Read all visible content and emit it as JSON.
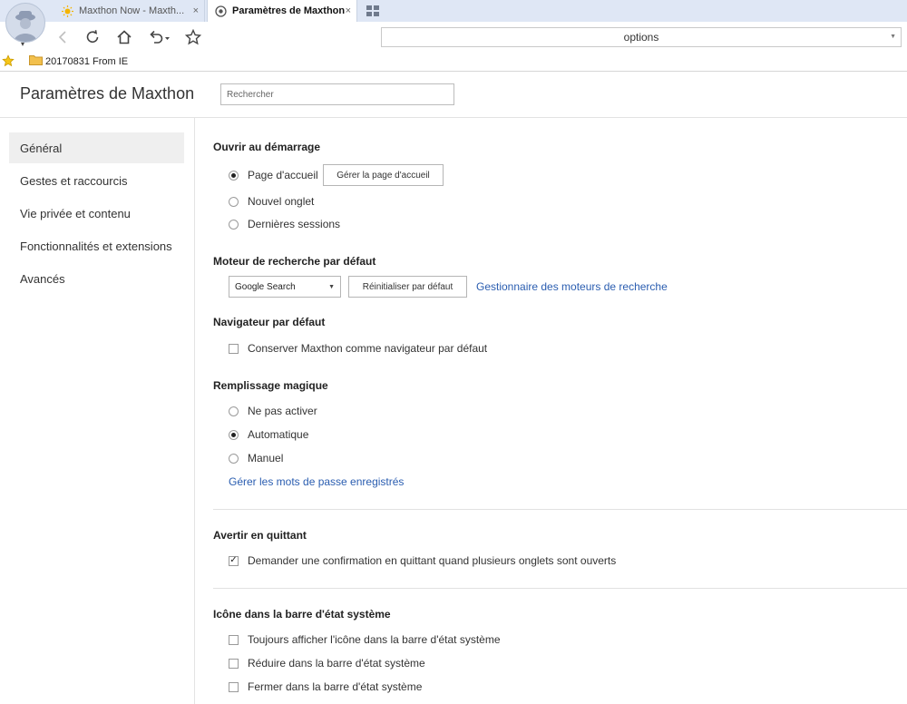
{
  "browser": {
    "tabs": [
      {
        "title": "Maxthon Now - Maxth...",
        "active": false
      },
      {
        "title": "Paramètres de Maxthon",
        "active": true
      }
    ],
    "close_glyph": "×",
    "address": "options",
    "favorites": [
      {
        "label": "20170831 From IE"
      }
    ],
    "icons": [
      "user-avatar-icon",
      "sun-icon",
      "settings-icon",
      "tile-grid-icon",
      "back-icon",
      "reload-icon",
      "home-icon",
      "undo-icon",
      "star-icon",
      "folder-icon"
    ]
  },
  "header": {
    "title": "Paramètres de Maxthon",
    "search_placeholder": "Rechercher"
  },
  "sidebar": {
    "items": [
      {
        "label": "Général",
        "selected": true
      },
      {
        "label": "Gestes et raccourcis"
      },
      {
        "label": "Vie privée et contenu"
      },
      {
        "label": "Fonctionnalités et extensions"
      },
      {
        "label": "Avancés"
      }
    ]
  },
  "sections": {
    "startup": {
      "title": "Ouvrir au démarrage",
      "options": [
        {
          "label": "Page d'accueil",
          "checked": true
        },
        {
          "label": "Nouvel onglet",
          "checked": false
        },
        {
          "label": "Dernières sessions",
          "checked": false
        }
      ],
      "manage_home_button": "Gérer la page d'accueil"
    },
    "search_engine": {
      "title": "Moteur de recherche par défaut",
      "selected": "Google Search",
      "reset_button": "Réinitialiser par défaut",
      "manager_link": "Gestionnaire des moteurs de recherche"
    },
    "default_browser": {
      "title": "Navigateur par défaut",
      "option": {
        "label": "Conserver Maxthon comme navigateur par défaut",
        "checked": false
      }
    },
    "magic_fill": {
      "title": "Remplissage magique",
      "options": [
        {
          "label": "Ne pas activer",
          "checked": false
        },
        {
          "label": "Automatique",
          "checked": true
        },
        {
          "label": "Manuel",
          "checked": false
        }
      ],
      "passwords_link": "Gérer les mots de passe enregistrés"
    },
    "quit_warning": {
      "title": "Avertir en quittant",
      "option": {
        "label": "Demander une confirmation en quittant quand plusieurs onglets sont ouverts",
        "checked": true
      }
    },
    "tray": {
      "title": "Icône dans la barre d'état système",
      "options": [
        {
          "label": "Toujours afficher l'icône dans la barre d'état système",
          "checked": false
        },
        {
          "label": "Réduire dans la barre d'état système",
          "checked": false
        },
        {
          "label": "Fermer dans la barre d'état système",
          "checked": false
        }
      ]
    }
  },
  "colors": {
    "chrome_bg": "#dfe7f5",
    "link": "#2a5db0",
    "sidebar_selected": "#efefef"
  }
}
